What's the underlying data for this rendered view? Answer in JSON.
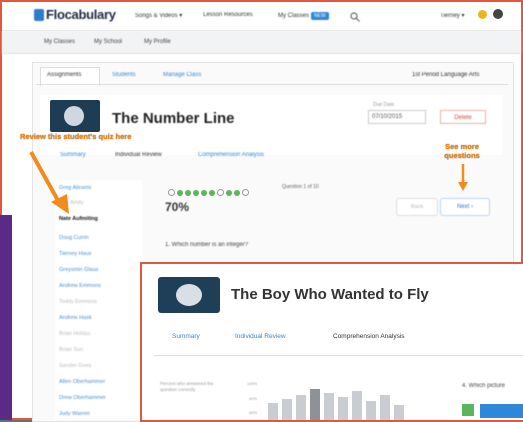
{
  "app": {
    "logo": "Flocabulary"
  },
  "topnav": {
    "items": [
      "Songs & Videos ▾",
      "Lesson Resources",
      "My Classes"
    ],
    "new_badge": "NEW",
    "user": "Tierney ▾"
  },
  "subnav": {
    "items": [
      "My Classes",
      "My School",
      "My Profile"
    ]
  },
  "class_tabs": {
    "items": [
      "Assignments",
      "Students",
      "Manage Class"
    ],
    "class_name": "1st Period Language Arts"
  },
  "assignment": {
    "title": "The Number Line",
    "due_label": "Due Date",
    "due_date": "07/10/2015",
    "delete_label": "Delete",
    "tabs": [
      "Summary",
      "Individual Review",
      "Comprehension Analysis"
    ]
  },
  "students": [
    {
      "name": "Greg Abrams",
      "state": "link"
    },
    {
      "name": "Ben Amity",
      "state": "grey"
    },
    {
      "name": "Nate Aufmiting",
      "state": "selected"
    },
    {
      "name": "Doug Currin",
      "state": "link"
    },
    {
      "name": "Tierney Haus",
      "state": "link"
    },
    {
      "name": "Greysmin Glaus",
      "state": "link"
    },
    {
      "name": "Andrew Emmons",
      "state": "link"
    },
    {
      "name": "Toddy Emmons",
      "state": "grey"
    },
    {
      "name": "Andrew Hask",
      "state": "link"
    },
    {
      "name": "Brian Holdas",
      "state": "grey"
    },
    {
      "name": "Brian Sun",
      "state": "grey"
    },
    {
      "name": "Sander Goes",
      "state": "grey"
    },
    {
      "name": "Allen Oberhammer",
      "state": "link"
    },
    {
      "name": "Drew Oberhammer",
      "state": "link"
    },
    {
      "name": "Judy Warren",
      "state": "link"
    }
  ],
  "quiz": {
    "question_progress": "Question 1 of 10",
    "score": "70%",
    "back_label": "Back",
    "next_label": "Next",
    "question": "1. Which number is an integer?"
  },
  "annotations": {
    "left": "Review this student's quiz here",
    "right": "See more questions"
  },
  "front": {
    "title": "The Boy Who Wanted to Fly",
    "tabs": [
      "Summary",
      "Individual Review",
      "Comprehension Analysis"
    ],
    "chart_caption": "Percent who answered the question correctly",
    "y_ticks": [
      "100%",
      "80%",
      "60%"
    ],
    "right_question": "4. Which picture"
  },
  "colors": {
    "accent": "#2e7bd0",
    "annotation": "#f28a1e",
    "frame": "#e2583e",
    "correct": "#5bb55b"
  }
}
